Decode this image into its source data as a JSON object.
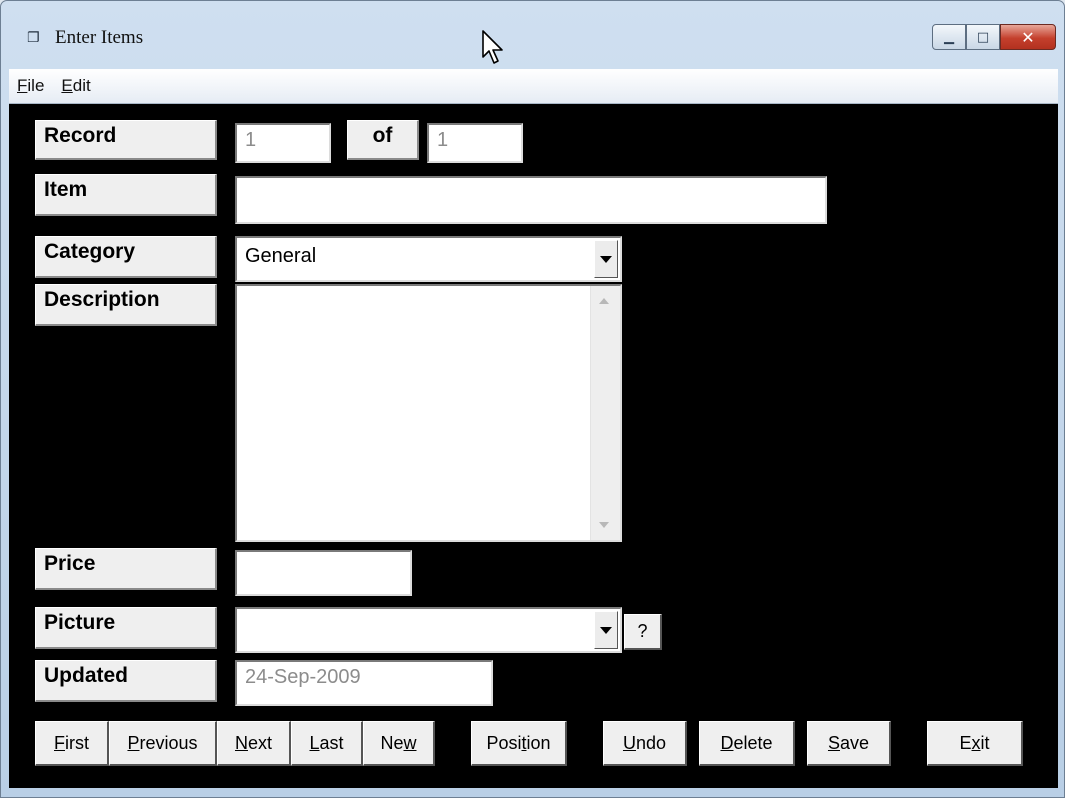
{
  "window": {
    "title": "Enter Items",
    "icon": "form-window-icon",
    "controls": {
      "minimize": "minimize-icon",
      "maximize": "maximize-icon",
      "close": "close-icon"
    }
  },
  "menu": {
    "items": [
      {
        "mnemonic": "F",
        "rest": "ile"
      },
      {
        "mnemonic": "E",
        "rest": "dit"
      }
    ]
  },
  "form": {
    "record_label": "Record",
    "record_value": "1",
    "of_label": "of",
    "record_total": "1",
    "item_label": "Item",
    "item_value": "",
    "category_label": "Category",
    "category_value": "General",
    "description_label": "Description",
    "description_value": "",
    "price_label": "Price",
    "price_value": "",
    "picture_label": "Picture",
    "picture_value": "",
    "picture_help": "?",
    "updated_label": "Updated",
    "updated_value": "24-Sep-2009"
  },
  "buttons": {
    "first": {
      "pre": "",
      "mn": "F",
      "post": "irst"
    },
    "previous": {
      "pre": "",
      "mn": "P",
      "post": "revious"
    },
    "next": {
      "pre": "",
      "mn": "N",
      "post": "ext"
    },
    "last": {
      "pre": "",
      "mn": "L",
      "post": "ast"
    },
    "new": {
      "pre": "Ne",
      "mn": "w",
      "post": ""
    },
    "position": {
      "pre": "Posi",
      "mn": "t",
      "post": "ion"
    },
    "undo": {
      "pre": "",
      "mn": "U",
      "post": "ndo"
    },
    "delete": {
      "pre": "",
      "mn": "D",
      "post": "elete"
    },
    "save": {
      "pre": "",
      "mn": "S",
      "post": "ave"
    },
    "exit": {
      "pre": "E",
      "mn": "x",
      "post": "it"
    }
  },
  "colors": {
    "form_background": "#000000",
    "label_background": "#efefef",
    "close_button": "#c4402d"
  }
}
